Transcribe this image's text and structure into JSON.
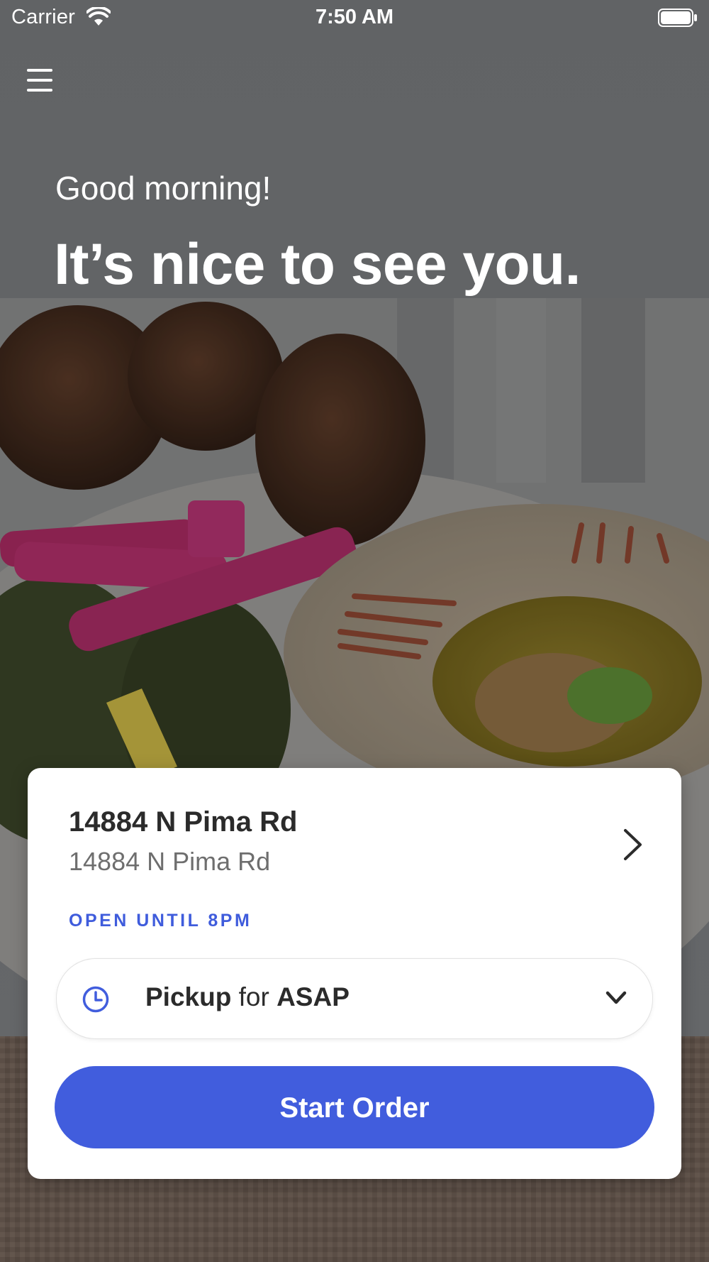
{
  "status_bar": {
    "carrier": "Carrier",
    "time": "7:50 AM"
  },
  "header": {
    "menu_icon": "hamburger-menu-icon"
  },
  "greeting": {
    "line1": "Good morning!",
    "line2": "It’s nice to see you."
  },
  "store_card": {
    "name": "14884 N Pima Rd",
    "address": "14884 N Pima Rd",
    "hours": "OPEN UNTIL 8PM",
    "order_mode": {
      "method": "Pickup",
      "connector": "for",
      "time": "ASAP",
      "icon": "clock-icon"
    },
    "start_order_label": "Start Order"
  },
  "colors": {
    "accent": "#415ddd",
    "hours_text": "#3f5cdc",
    "card_bg": "#ffffff",
    "title_text": "#2b2b2b",
    "secondary_text": "#6e6e6e"
  }
}
